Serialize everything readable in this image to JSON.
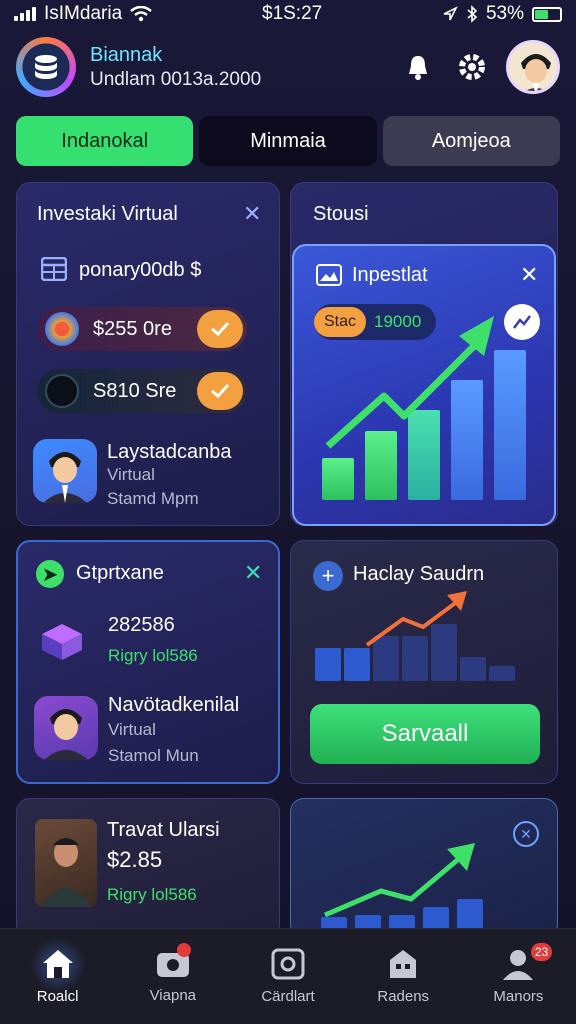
{
  "status_bar": {
    "carrier": "IsIMdaria",
    "time": "$1S:27",
    "battery_percent": "53%",
    "battery_level": 0.53
  },
  "header": {
    "brand": "Biannak",
    "balance": "Undlam 0013a.2000"
  },
  "tabs": [
    {
      "label": "Indanokal",
      "active": true
    },
    {
      "label": "Minmaia",
      "active": false
    },
    {
      "label": "Aomjeoa",
      "active": false
    }
  ],
  "card_investasi": {
    "title": "Investaki Virtual",
    "row_label": "ponary00db $",
    "pills": [
      {
        "label": "$255 0re"
      },
      {
        "label": "S810 Sre"
      }
    ],
    "person_name": "Laystadcanba",
    "person_sub1": "Virtual",
    "person_sub2": "Stamd Mpm"
  },
  "card_stoust": {
    "title": "Stousi"
  },
  "card_inpestiat": {
    "title": "Inpestlat",
    "tag": "Stac",
    "amount": "19000",
    "bars": [
      0.28,
      0.46,
      0.6,
      0.8,
      1.0
    ]
  },
  "card_gtprtxane": {
    "title": "Gtprtxane",
    "value": "282586",
    "value_sub": "Rigry lol586",
    "person_name": "Navötadkenilal",
    "person_sub1": "Virtual",
    "person_sub2": "Stamol Mun"
  },
  "card_haclay": {
    "title": "Haclay Saudrn",
    "button": "Sarvaall",
    "bars": [
      0.55,
      0.55,
      0.75,
      0.75,
      0.95,
      0.4,
      0.25
    ]
  },
  "card_travat": {
    "name": "Travat Ularsi",
    "value": "$2.85",
    "value_sub": "Rigry lol586"
  },
  "card_chart2": {
    "bars": [
      0.3,
      0.35,
      0.35,
      0.55,
      0.75
    ]
  },
  "bottom_nav": [
    {
      "label": "Roalcl",
      "active": true,
      "badge": ""
    },
    {
      "label": "Viapna",
      "active": false,
      "badge": "dot"
    },
    {
      "label": "Cärdlart",
      "active": false,
      "badge": ""
    },
    {
      "label": "Radens",
      "active": false,
      "badge": ""
    },
    {
      "label": "Manors",
      "active": false,
      "badge": "23"
    }
  ],
  "colors": {
    "accent_green": "#3ee06a",
    "accent_orange": "#f2a040",
    "card_bg": "#23225a",
    "cyan": "#6ee4ff"
  },
  "icons": [
    "signal-icon",
    "wifi-icon",
    "location-icon",
    "bluetooth-icon",
    "battery-icon",
    "database-icon",
    "bell-icon",
    "gear-icon",
    "calendar-icon",
    "close-icon",
    "check-icon",
    "plus-icon",
    "trend-icon",
    "home-icon",
    "camera-icon",
    "person-icon"
  ]
}
